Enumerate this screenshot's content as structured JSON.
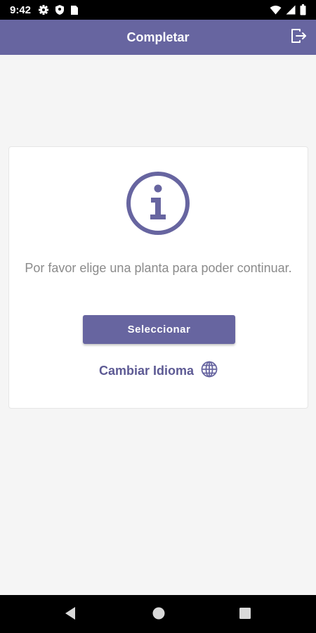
{
  "status_bar": {
    "time": "9:42",
    "left_icons": [
      "settings-icon",
      "shield-icon",
      "sim-card-icon"
    ],
    "right_icons": [
      "wifi-icon",
      "signal-icon",
      "battery-icon"
    ]
  },
  "app_bar": {
    "title": "Completar",
    "action_icon": "logout-icon",
    "color": "#6765a0"
  },
  "card": {
    "icon": "info-icon",
    "message": "Por favor elige una planta para poder continuar.",
    "select_button_label": "Seleccionar",
    "language_link_label": "Cambiar Idioma",
    "language_icon": "globe-icon"
  },
  "nav_bar": {
    "buttons": [
      "back-icon",
      "home-icon",
      "recents-icon"
    ]
  },
  "colors": {
    "primary": "#6765a0",
    "text_muted": "#8b8b8b",
    "background": "#f5f5f5"
  }
}
